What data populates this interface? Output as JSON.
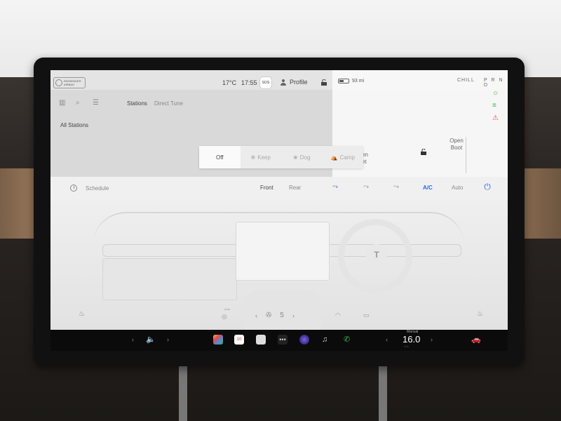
{
  "status_bar": {
    "airbag_label": "PASSENGER AIRBAG",
    "outside_temp": "17°C",
    "time": "17:55",
    "sos_label": "SOS",
    "profile_label": "Profile",
    "range": "93 mi",
    "battery_level": 0.5,
    "drive_mode": "CHILL",
    "gear": "P R N D"
  },
  "media": {
    "tabs": [
      "Stations",
      "Direct Tune"
    ],
    "list_title": "All Stations"
  },
  "car_panel": {
    "open_boot": "Open Boot",
    "partial_text": "en\net"
  },
  "camp_mode": {
    "options": [
      "Off",
      "Keep",
      "Dog",
      "Camp"
    ],
    "selected": "Off"
  },
  "climate": {
    "schedule_label": "Schedule",
    "zone_front": "Front",
    "zone_rear": "Rear",
    "ac_label": "A/C",
    "auto_label": "Auto",
    "fan_label": "Auto",
    "fan_speed": "5"
  },
  "dock": {
    "calendar_day": "10",
    "temp_mode": "Manual",
    "set_temp": "16.0"
  },
  "colors": {
    "accent_blue": "#2a6de0",
    "indicator_green": "#3bb34a",
    "indicator_red": "#d9534f"
  }
}
